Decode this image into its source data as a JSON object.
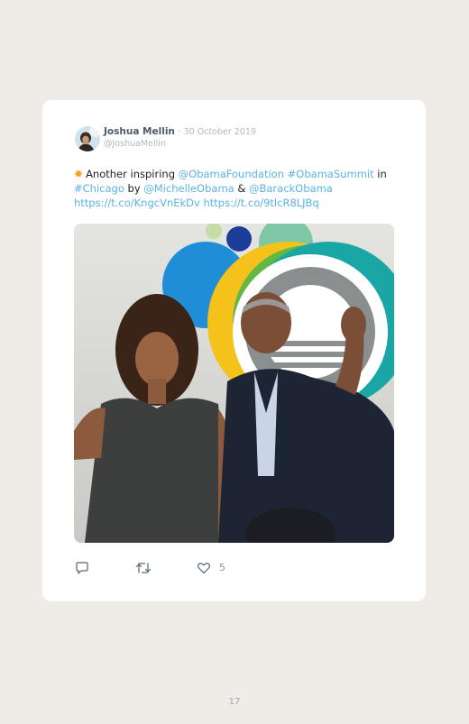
{
  "tweet": {
    "display_name": "Joshua Mellin",
    "separator": "·",
    "date": "30 October 2019",
    "handle": "@JoshuaMellin",
    "text_parts": [
      {
        "t": "Another inspiring ",
        "link": false
      },
      {
        "t": "@ObamaFoundation",
        "link": true
      },
      {
        "t": " ",
        "link": false
      },
      {
        "t": "#ObamaSummit",
        "link": true
      },
      {
        "t": " in ",
        "link": false
      },
      {
        "t": "#Chicago",
        "link": true
      },
      {
        "t": " by ",
        "link": false
      },
      {
        "t": "@MichelleObama",
        "link": true
      },
      {
        "t": " & ",
        "link": false
      },
      {
        "t": "@BarackObama",
        "link": true
      },
      {
        "t": " ",
        "link": false
      },
      {
        "t": "https://t.co/KngcVnEkDv",
        "link": true
      },
      {
        "t": " ",
        "link": false
      },
      {
        "t": "https://t.co/9tlcR8LJBq",
        "link": true
      }
    ],
    "emoji_icon": "star-emoji-icon",
    "like_count": "5"
  },
  "icons": {
    "reply": "reply-icon",
    "retweet": "retweet-icon",
    "like": "heart-icon"
  },
  "colors": {
    "page_background": "#efebe6",
    "card_background": "#ffffff",
    "link": "#5ab3e3",
    "muted": "#b1b8bf"
  },
  "page_number": "17"
}
